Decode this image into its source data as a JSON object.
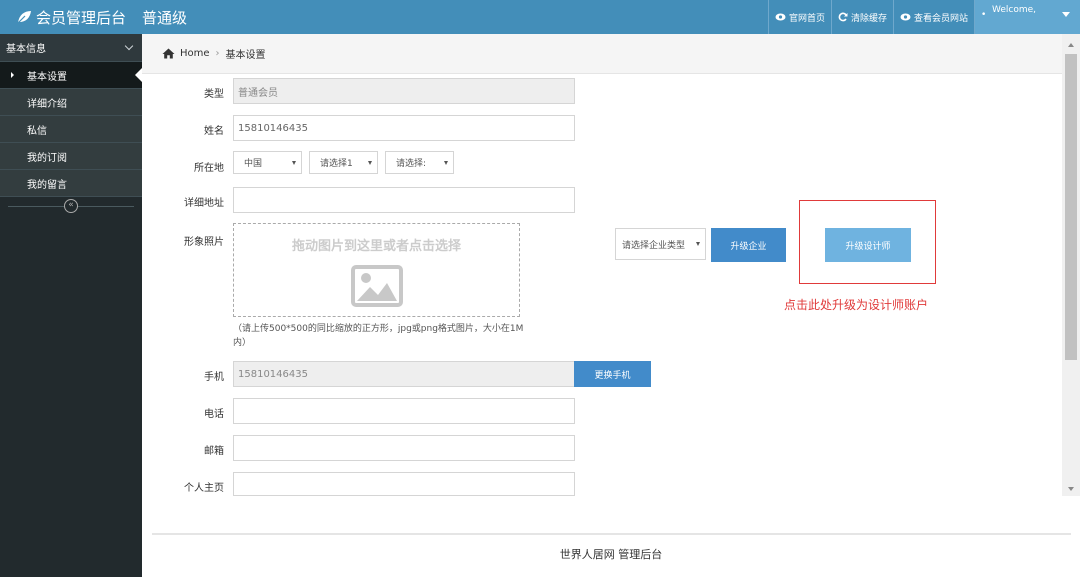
{
  "header": {
    "app_title": "会员管理后台",
    "member_level": "普通级",
    "nav": [
      {
        "label": "官网首页",
        "icon": "eye-icon"
      },
      {
        "label": "清除缓存",
        "icon": "refresh-icon"
      },
      {
        "label": "查看会员网站",
        "icon": "eye-icon"
      }
    ],
    "user_welcome": "Welcome,"
  },
  "sidebar": {
    "section_title": "基本信息",
    "items": [
      {
        "label": "基本设置",
        "active": true
      },
      {
        "label": "详细介绍"
      },
      {
        "label": "私信"
      },
      {
        "label": "我的订阅"
      },
      {
        "label": "我的留言"
      }
    ],
    "collapse_glyph": "«"
  },
  "breadcrumb": {
    "home": "Home",
    "current": "基本设置"
  },
  "form": {
    "type_label": "类型",
    "type_value": "普通会员",
    "name_label": "姓名",
    "name_value": "15810146435",
    "location_label": "所在地",
    "country_value": "中国",
    "province_value": "请选择1",
    "city_value": "请选择:",
    "address_label": "详细地址",
    "address_value": "",
    "photo_label": "形象照片",
    "dropzone_text": "拖动图片到这里或者点击选择",
    "photo_hint": "（请上传500*500的同比缩放的正方形，jpg或png格式图片，大小在1M内）",
    "enterprise_type_placeholder": "请选择企业类型",
    "upgrade_enterprise_label": "升级企业",
    "upgrade_designer_label": "升级设计师",
    "annotation_text": "点击此处升级为设计师账户",
    "mobile_label": "手机",
    "mobile_value": "15810146435",
    "change_mobile_label": "更换手机",
    "phone_label": "电话",
    "phone_value": "",
    "email_label": "邮箱",
    "email_value": "",
    "homepage_label": "个人主页",
    "homepage_value": ""
  },
  "footer": {
    "text": "世界人居网 管理后台"
  },
  "colors": {
    "navbar": "#438eb9",
    "sidebar": "#222a2d",
    "button_light": "#6fb3e0",
    "button_primary": "#428bca",
    "annotation": "#e03a3a"
  }
}
